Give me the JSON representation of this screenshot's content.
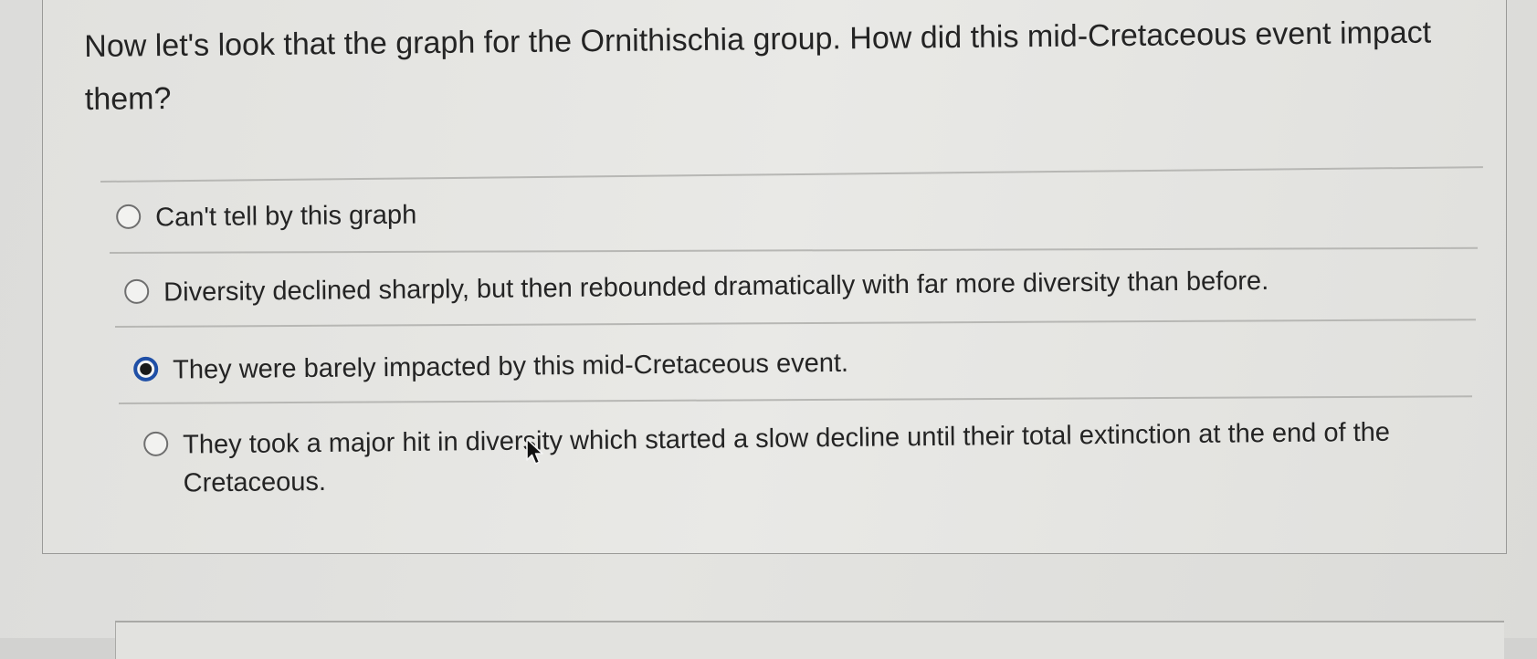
{
  "question": {
    "text": "Now let's look that the graph for the Ornithischia group. How did this mid-Cretaceous event impact them?"
  },
  "options": [
    {
      "label": "Can't tell by this graph",
      "selected": false
    },
    {
      "label": "Diversity declined sharply, but then rebounded dramatically with far more diversity than before.",
      "selected": false
    },
    {
      "label": "They were barely impacted by this mid-Cretaceous event.",
      "selected": true
    },
    {
      "label": "They took a major hit in diversity which started a slow decline until their total extinction at the end of the Cretaceous.",
      "selected": false
    }
  ],
  "colors": {
    "selected_radio": "#1f4fa6",
    "background": "#d2d2d0"
  },
  "icons": {
    "cursor": "mouse-pointer-icon"
  }
}
